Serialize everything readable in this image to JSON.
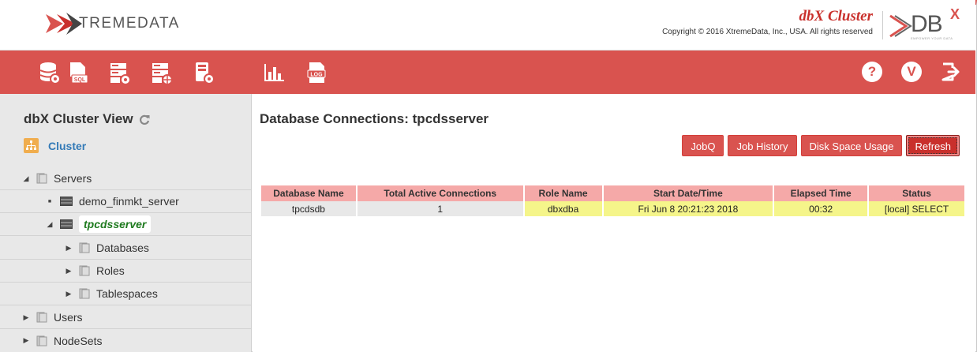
{
  "header": {
    "logo_text_prefix": "",
    "logo_text": "TREMEDATA",
    "product_name": "dbX Cluster",
    "copyright": "Copyright © 2016 XtremeData, Inc., USA. All rights reserved",
    "brand_logo_main": "DB",
    "brand_logo_sup": "X",
    "brand_tagline": "EMPOWER YOUR DATA"
  },
  "toolbar": {
    "icons": [
      "database-settings-icon",
      "sql-file-icon",
      "server-settings-icon",
      "server-gear-icon",
      "device-settings-icon",
      "bar-chart-icon",
      "log-icon"
    ],
    "right_icons": {
      "help": "?",
      "version": "V",
      "logout": "logout-icon"
    }
  },
  "sidebar": {
    "title": "dbX Cluster View",
    "cluster_label": "Cluster",
    "tree": {
      "servers": "Servers",
      "demo_server": "demo_finmkt_server",
      "tpcds_server": "tpcdsserver",
      "databases": "Databases",
      "roles": "Roles",
      "tablespaces": "Tablespaces",
      "users": "Users",
      "nodesets": "NodeSets"
    }
  },
  "main": {
    "title": "Database Connections: tpcdsserver",
    "buttons": {
      "jobq": "JobQ",
      "job_history": "Job History",
      "disk_space": "Disk Space Usage",
      "refresh": "Refresh"
    },
    "table": {
      "headers": [
        "Database Name",
        "Total Active Connections",
        "Role Name",
        "Start Date/Time",
        "Elapsed Time",
        "Status"
      ],
      "rows": [
        [
          "tpcdsdb",
          "1",
          "dbxdba",
          "Fri Jun 8 20:21:23 2018",
          "00:32",
          "[local] SELECT"
        ]
      ]
    }
  },
  "colors": {
    "accent": "#d9534f",
    "header_row": "#f5a9a8",
    "highlight": "#f5f58a"
  }
}
